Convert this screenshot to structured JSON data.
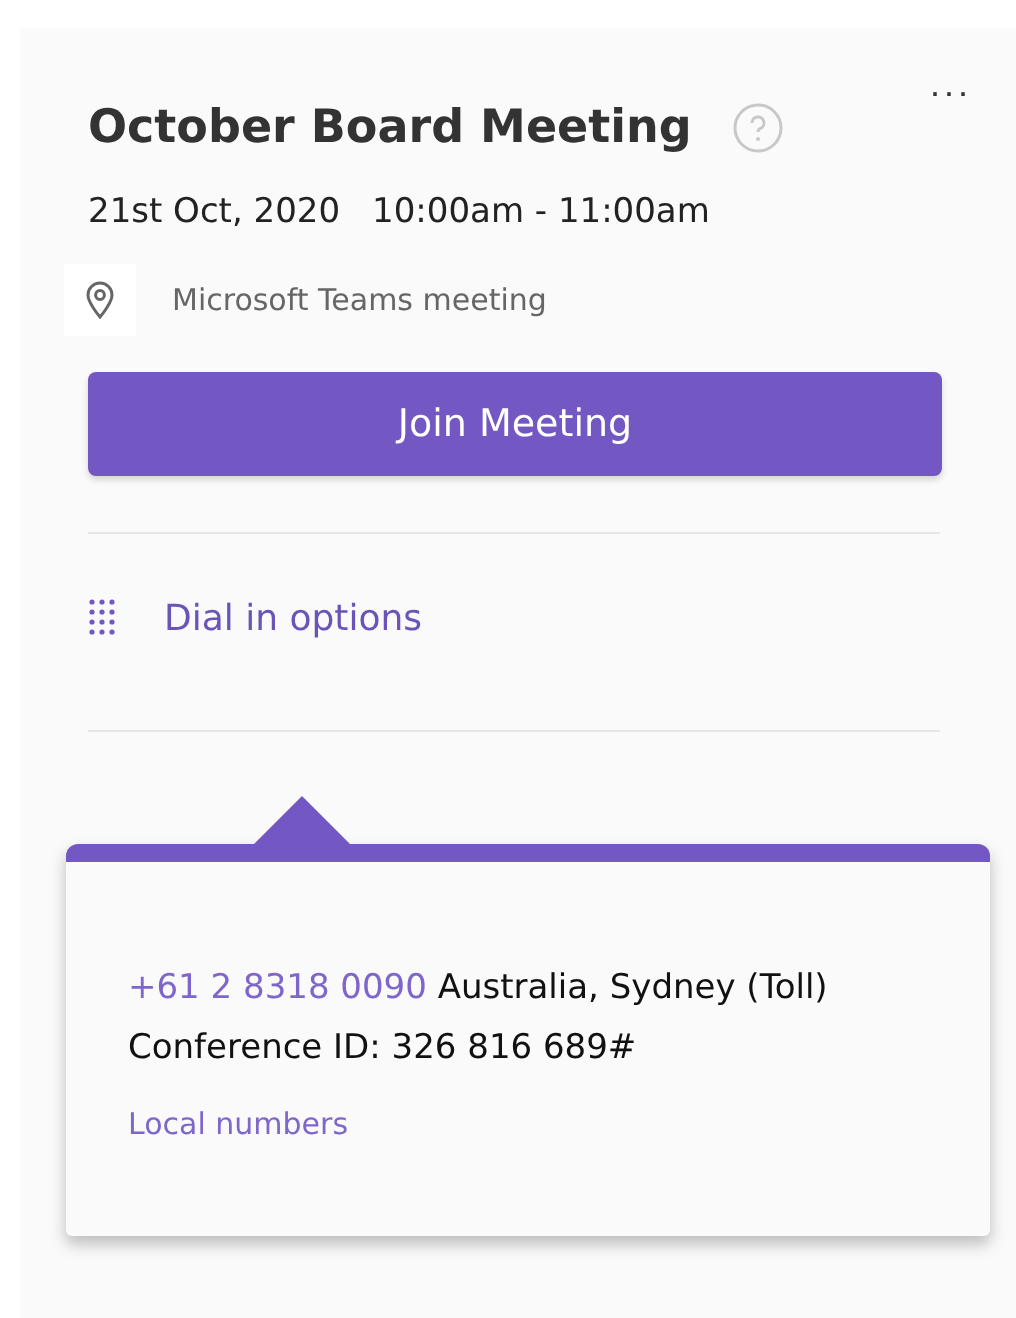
{
  "meeting": {
    "title": "October Board Meeting",
    "date": "21st Oct, 2020",
    "time": "10:00am - 11:00am",
    "location": "Microsoft Teams meeting"
  },
  "more_button": "...",
  "join_button": "Join Meeting",
  "dial_in": {
    "label": "Dial in options"
  },
  "popup": {
    "phone": "+61 2 8318 0090",
    "phone_desc": "Australia, Sydney (Toll)",
    "conference_id": "Conference ID: 326 816 689#",
    "link": "Local numbers"
  }
}
